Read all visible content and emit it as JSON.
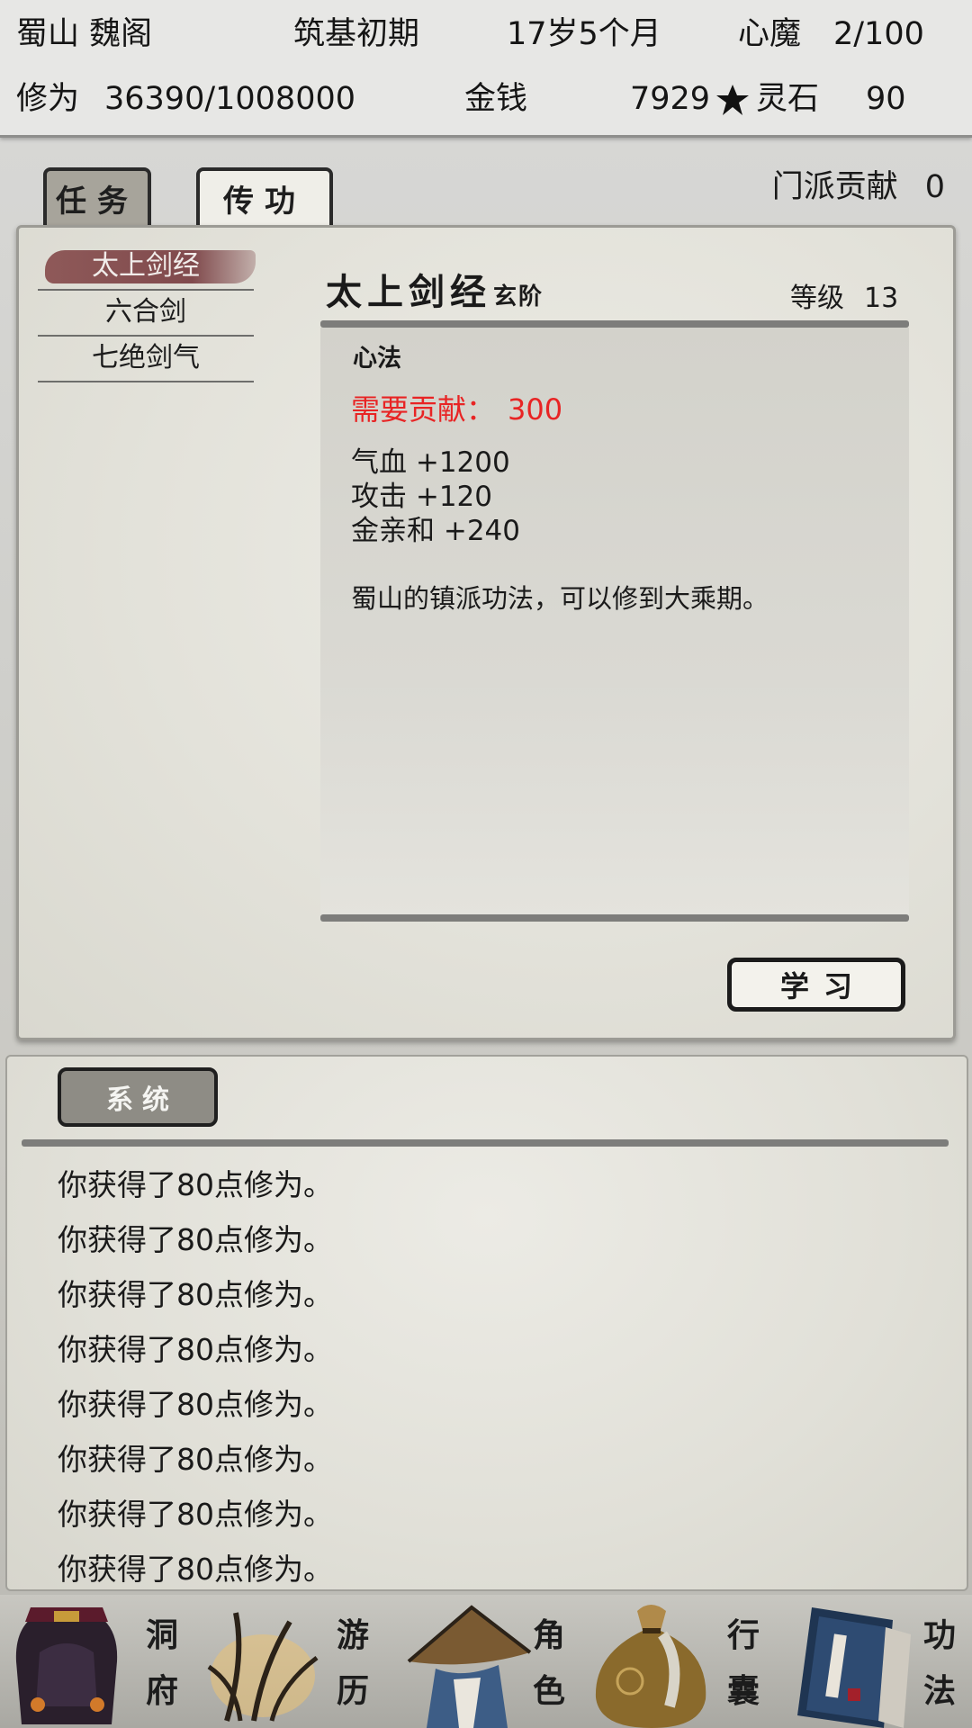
{
  "status": {
    "sect_name": "蜀山 魏阁",
    "realm": "筑基初期",
    "age": "17岁5个月",
    "inner_demon_label": "心魔",
    "inner_demon_value": "2/100",
    "cultivation_label": "修为",
    "cultivation_value": "36390/1008000",
    "money_label": "金钱",
    "money_value": "7929",
    "spirit_stone_label": "灵石",
    "spirit_stone_value": "90"
  },
  "tabs": [
    {
      "label": "任务",
      "active": true
    },
    {
      "label": "传功",
      "active": false
    }
  ],
  "sect_contribution": {
    "label": "门派贡献",
    "value": "0"
  },
  "skill_list": [
    {
      "name": "太上剑经",
      "selected": true
    },
    {
      "name": "六合剑",
      "selected": false
    },
    {
      "name": "七绝剑气",
      "selected": false
    }
  ],
  "skill_detail": {
    "title": "太上剑经",
    "tier": "玄阶",
    "level_label": "等级",
    "level_value": "13",
    "category": "心法",
    "requirement_label": "需要贡献：",
    "requirement_value": "300",
    "stats": [
      "气血 +1200",
      "攻击 +120",
      "金亲和 +240"
    ],
    "description": "蜀山的镇派功法，可以修到大乘期。"
  },
  "learn_button": "学习",
  "log": {
    "tab_label": "系统",
    "lines": [
      "你获得了80点修为。",
      "你获得了80点修为。",
      "你获得了80点修为。",
      "你获得了80点修为。",
      "你获得了80点修为。",
      "你获得了80点修为。",
      "你获得了80点修为。",
      "你获得了80点修为。"
    ]
  },
  "bottom_nav": [
    {
      "label_top": "洞",
      "label_bottom": "府",
      "icon": "mansion-icon"
    },
    {
      "label_top": "游",
      "label_bottom": "历",
      "icon": "travel-icon"
    },
    {
      "label_top": "角",
      "label_bottom": "色",
      "icon": "character-icon"
    },
    {
      "label_top": "行",
      "label_bottom": "囊",
      "icon": "bag-icon"
    },
    {
      "label_top": "功",
      "label_bottom": "法",
      "icon": "scripture-icon"
    }
  ],
  "colors": {
    "requirement_red": "#e82424",
    "selected_skill": "#7a3e44",
    "paper": "#e6e5de"
  }
}
